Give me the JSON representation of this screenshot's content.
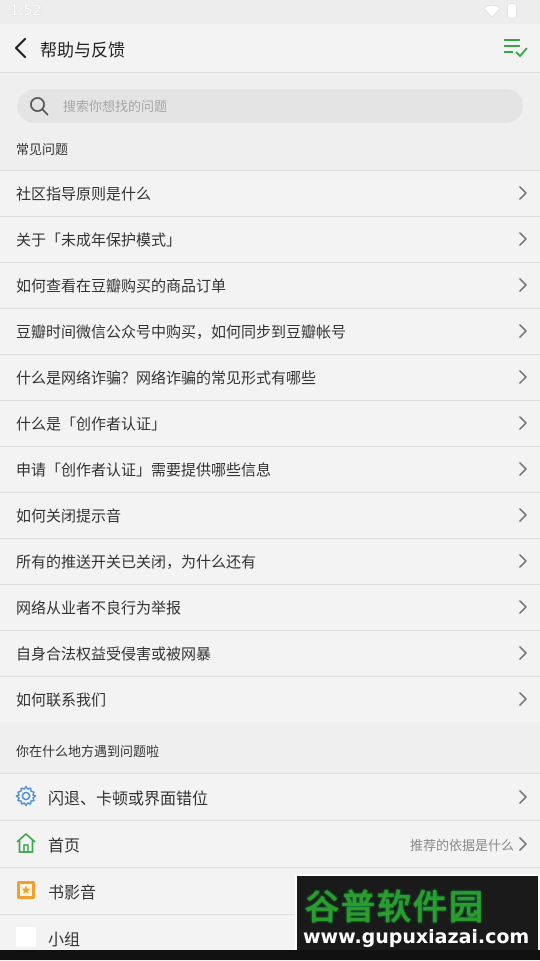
{
  "status": {
    "time": "1:52"
  },
  "header": {
    "title": "帮助与反馈"
  },
  "search": {
    "placeholder": "搜索你想找的问题"
  },
  "faq": {
    "section_title": "常见问题",
    "items": [
      "社区指导原则是什么",
      "关于「未成年保护模式」",
      "如何查看在豆瓣购买的商品订单",
      "豆瓣时间微信公众号中购买，如何同步到豆瓣帐号",
      "什么是网络诈骗？网络诈骗的常见形式有哪些",
      "什么是「创作者认证」",
      "申请「创作者认证」需要提供哪些信息",
      "如何关闭提示音",
      "所有的推送开关已关闭，为什么还有",
      "网络从业者不良行为举报",
      "自身合法权益受侵害或被网暴",
      "如何联系我们"
    ]
  },
  "where": {
    "section_title": "你在什么地方遇到问题啦",
    "items": [
      {
        "label": "闪退、卡顿或界面错位",
        "icon": "gear-icon",
        "hint": ""
      },
      {
        "label": "首页",
        "icon": "home-icon",
        "hint": "推荐的依据是什么"
      },
      {
        "label": "书影音",
        "icon": "star-box-icon",
        "hint": ""
      },
      {
        "label": "小组",
        "icon": "group-icon",
        "hint": ""
      }
    ]
  },
  "watermark": {
    "top": "谷普软件园",
    "bottom": "www.gupuxiazai.com"
  },
  "colors": {
    "accent": "#3aa64a",
    "icon_blue": "#4a8fd6",
    "icon_orange": "#f0a030"
  }
}
